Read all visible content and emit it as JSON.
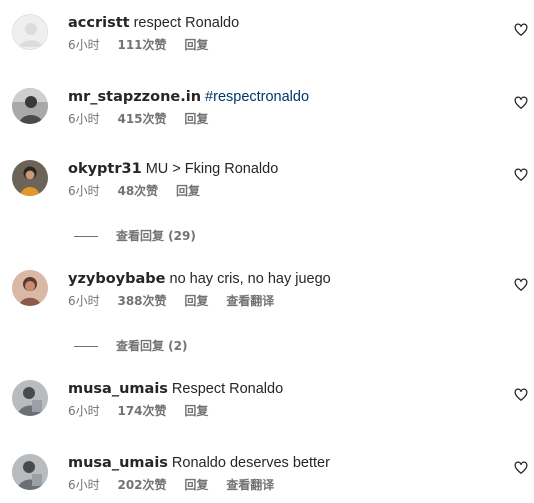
{
  "comments": [
    {
      "username": "accristt",
      "text": "respect Ronaldo",
      "time": "6小时",
      "likes": "111次赞",
      "reply": "回复",
      "avatar": "default-avatar"
    },
    {
      "username": "mr_stapzzone.in",
      "text": "#respectronaldo",
      "time": "6小时",
      "likes": "415次赞",
      "reply": "回复",
      "avatar": "person-avatar"
    },
    {
      "username": "okyptr31",
      "text": "MU > Fking Ronaldo",
      "time": "6小时",
      "likes": "48次赞",
      "reply": "回复",
      "avatar": "person-avatar"
    },
    {
      "username": "yzyboybabe",
      "text": "no hay cris, no hay juego",
      "time": "6小时",
      "likes": "388次赞",
      "reply": "回复",
      "translate": "查看翻译",
      "avatar": "person-avatar"
    },
    {
      "username": "musa_umais",
      "text": "Respect Ronaldo",
      "time": "6小时",
      "likes": "174次赞",
      "reply": "回复",
      "avatar": "person-avatar"
    },
    {
      "username": "musa_umais",
      "text": "Ronaldo deserves better",
      "time": "6小时",
      "likes": "202次赞",
      "reply": "回复",
      "translate": "查看翻译",
      "avatar": "person-avatar"
    }
  ],
  "view_replies": [
    {
      "label": "查看回复 (29)"
    },
    {
      "label": "查看回复 (2)"
    }
  ],
  "icons": {
    "like": "heart-icon"
  },
  "colors": {
    "hashtag": "#00376b",
    "meta": "#737373",
    "text": "#262626"
  }
}
